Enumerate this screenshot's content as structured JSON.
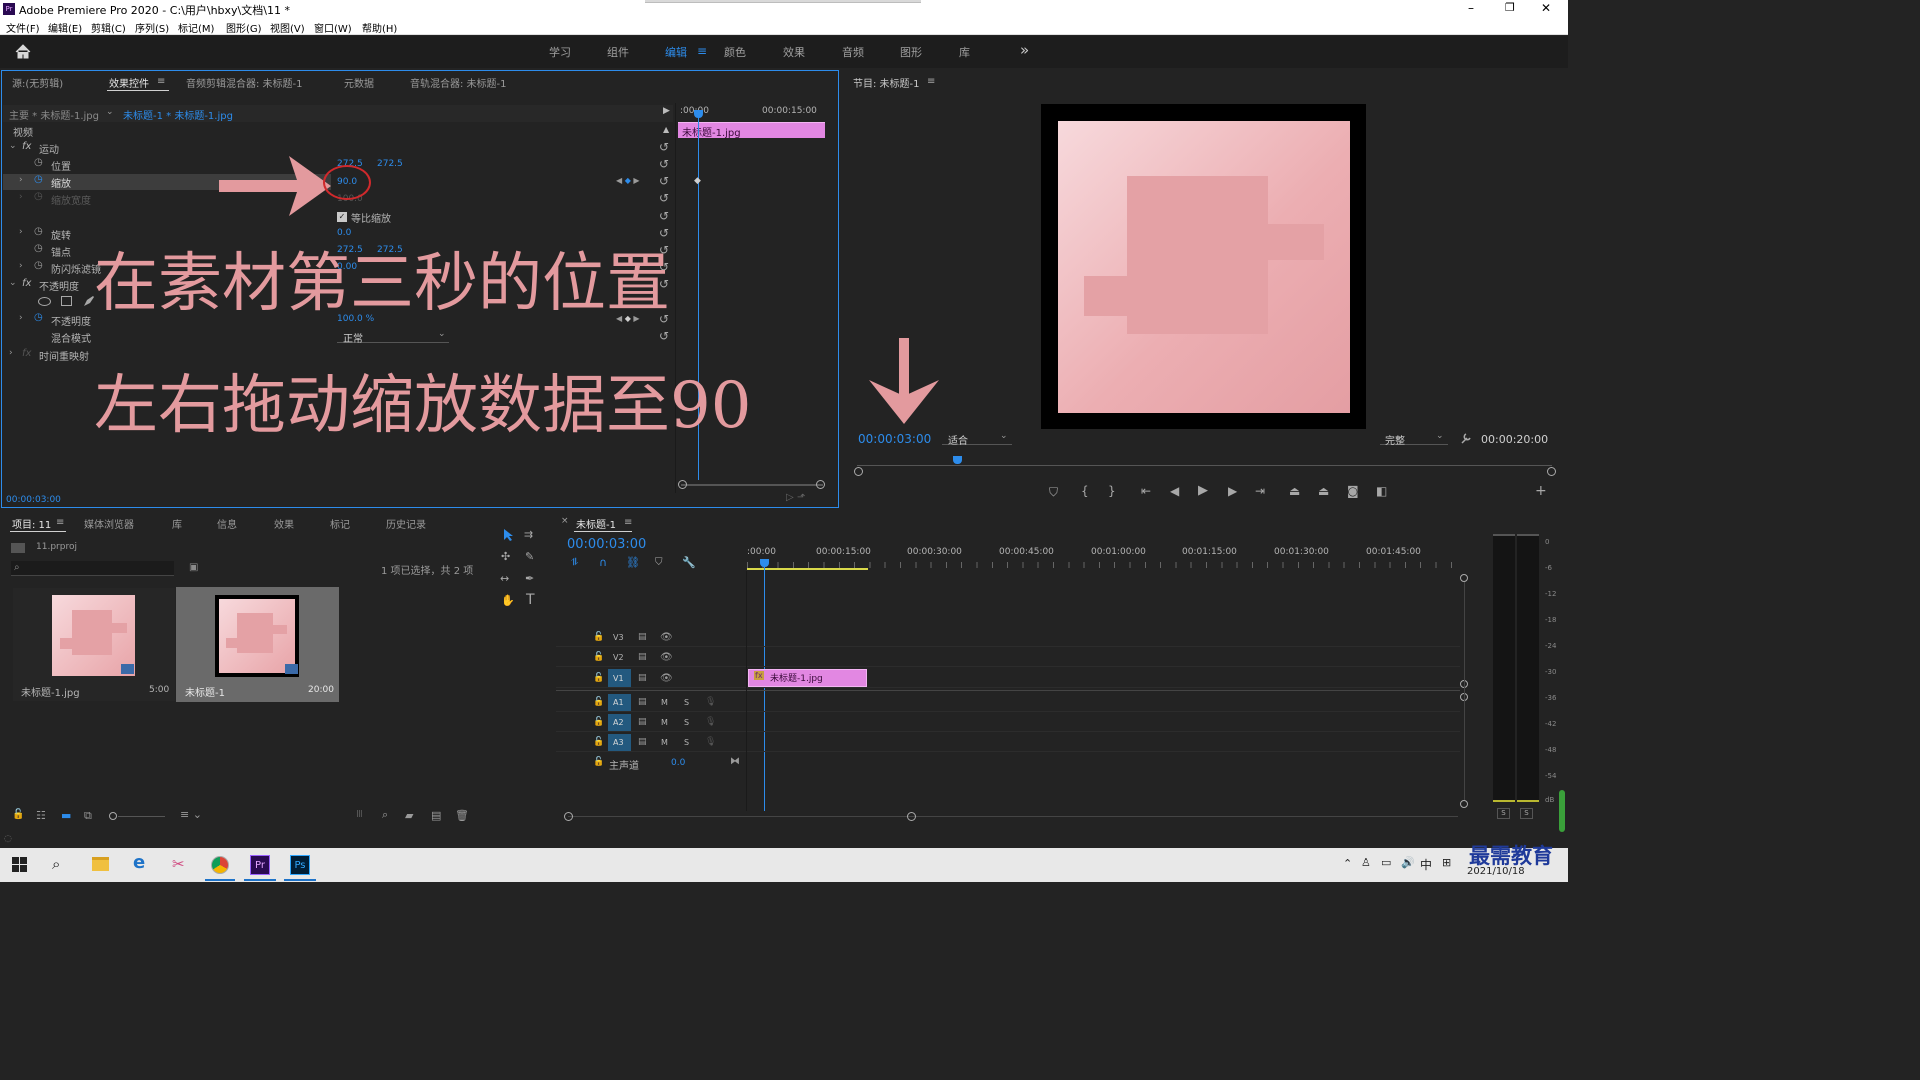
{
  "app": {
    "title": "Adobe Premiere Pro 2020 - C:\\用户\\hbxy\\文档\\11 *",
    "min": "–",
    "restore": "❐",
    "close": "✕"
  },
  "menu": [
    "文件(F)",
    "编辑(E)",
    "剪辑(C)",
    "序列(S)",
    "标记(M)",
    "图形(G)",
    "视图(V)",
    "窗口(W)",
    "帮助(H)"
  ],
  "workspaces": [
    "学习",
    "组件",
    "编辑",
    "颜色",
    "效果",
    "音频",
    "图形",
    "库"
  ],
  "workspace_more": "»",
  "source_tabs": [
    "源:(无剪辑)",
    "效果控件",
    "音频剪辑混合器: 未标题-1",
    "元数据",
    "音轨混合器: 未标题-1"
  ],
  "ec": {
    "master": "主要 * 未标题-1.jpg",
    "seq_clip": "未标题-1 * 未标题-1.jpg",
    "t0": ":00:00",
    "t15": "00:00:15:00",
    "clip": "未标题-1.jpg",
    "video": "视频",
    "motion": "运动",
    "position": "位置",
    "pos_x": "272.5",
    "pos_y": "272.5",
    "scale": "缩放",
    "scale_val": "90.0",
    "scale_w": "缩放宽度",
    "scale_w_val": "100.0",
    "uniform": "等比缩放",
    "rotation": "旋转",
    "rotation_val": "0.0",
    "anchor": "锚点",
    "anchor_x": "272.5",
    "anchor_y": "272.5",
    "flicker": "防闪烁滤镜",
    "flicker_val": "0.00",
    "opacity_group": "不透明度",
    "opacity": "不透明度",
    "opacity_val": "100.0 %",
    "blend": "混合模式",
    "blend_val": "正常",
    "remap": "时间重映射",
    "timecode": "00:00:03:00"
  },
  "annotation": {
    "line1": "在素材第三秒的位置",
    "line2": "左右拖动缩放数据至90"
  },
  "program": {
    "title": "节目: 未标题-1",
    "timecode": "00:00:03:00",
    "fit": "适合",
    "quality": "完整",
    "duration": "00:00:20:00"
  },
  "project": {
    "tabs": [
      "项目: 11",
      "媒体浏览器",
      "库",
      "信息",
      "效果",
      "标记",
      "历史记录"
    ],
    "file": "11.prproj",
    "status": "1 项已选择，共 2 项",
    "items": [
      {
        "name": "未标题-1.jpg",
        "dur": "5:00"
      },
      {
        "name": "未标题-1",
        "dur": "20:00"
      }
    ]
  },
  "timeline": {
    "tab": "未标题-1",
    "timecode": "00:00:03:00",
    "ruler": [
      ":00:00",
      "00:00:15:00",
      "00:00:30:00",
      "00:00:45:00",
      "00:01:00:00",
      "00:01:15:00",
      "00:01:30:00",
      "00:01:45:00"
    ],
    "video_tracks": [
      "V3",
      "V2",
      "V1"
    ],
    "audio_tracks": [
      "A1",
      "A2",
      "A3"
    ],
    "master": "主声道",
    "master_val": "0.0",
    "clip": "未标题-1.jpg",
    "m": "M",
    "s": "S"
  },
  "meter": {
    "scale": [
      "0",
      "-6",
      "-12",
      "-18",
      "-24",
      "-30",
      "-36",
      "-42",
      "-48",
      "-54",
      "dB"
    ],
    "solo": "S"
  },
  "taskbar": {
    "ime": "中",
    "date": "2021/10/18",
    "watermark": "最需教育"
  },
  "colors": {
    "accent": "#2d8ceb",
    "clip_pink": "#e287e2",
    "annotation": "#e39a9e",
    "marker_red": "#d0292c"
  }
}
